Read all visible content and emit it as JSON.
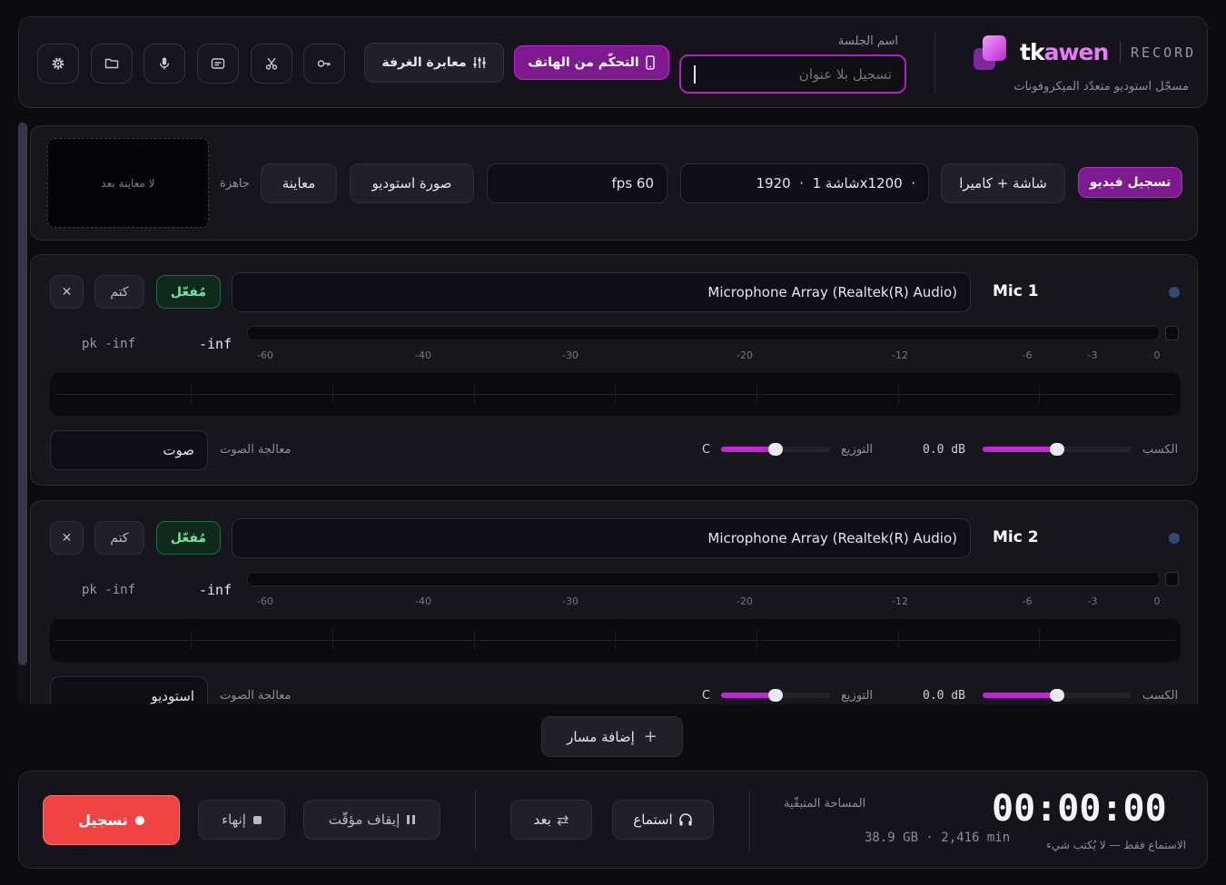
{
  "brand": {
    "tk": "tk",
    "awen": "awen",
    "record": "RECORD",
    "tagline": "مسجّل استوديو متعدّد الميكروفونات"
  },
  "session": {
    "label": "اسم الجلسة",
    "placeholder": "تسجيل بلا عنوان",
    "value": ""
  },
  "header": {
    "phone_control": "التحكّم من الهاتف",
    "room_calibration": "معايرة الغرفة"
  },
  "header_icons": [
    "key-icon",
    "scissors-icon",
    "subtitles-icon",
    "microphone-icon",
    "folder-icon",
    "settings-icon"
  ],
  "video": {
    "record_video": "تسجيل فيديو",
    "mode": "شاشة + كاميرا",
    "screen": "شاشة 1  ·  1920x1200  ·",
    "fps": "fps 60",
    "studio_image": "صورة استوديو",
    "preview": "معاينة",
    "ready": "جاهزة",
    "no_preview": "لا معاينة بعد"
  },
  "tracks": [
    {
      "name": "Mic 1",
      "device": "Microphone Array (Realtek(R) Audio)",
      "enabled": "مُفعّل",
      "mute": "كتم",
      "close": "✕",
      "level": "-inf",
      "peak": "pk -inf",
      "gain_label": "الكسب",
      "gain_value": "0.0 dB",
      "gain_level": 0.5,
      "pan_label": "التوزيع",
      "pan_value": "C",
      "pan_level": 0.5,
      "processing_label": "معالجة الصوت",
      "processing_value": "صوت"
    },
    {
      "name": "Mic 2",
      "device": "Microphone Array (Realtek(R) Audio)",
      "enabled": "مُفعّل",
      "mute": "كتم",
      "close": "✕",
      "level": "-inf",
      "peak": "pk -inf",
      "gain_label": "الكسب",
      "gain_value": "0.0 dB",
      "gain_level": 0.5,
      "pan_label": "التوزيع",
      "pan_value": "C",
      "pan_level": 0.5,
      "processing_label": "معالجة الصوت",
      "processing_value": "استوديو"
    }
  ],
  "meter_scale": [
    "-60",
    "-40",
    "-30",
    "-20",
    "-12",
    "-6",
    "-3",
    "0"
  ],
  "add_track": "إضافة مسار",
  "footer": {
    "record": "تسجيل",
    "finish": "إنهاء",
    "pause": "إيقاف مؤقّت",
    "remote": "بعد",
    "listen": "استماع",
    "space_label": "المساحة المتبقّية",
    "space_value": "38.9 GB · 2,416 min",
    "timer": "00:00:00",
    "listen_note": "الاستماع فقط — لا يُكتب شيء"
  },
  "colors": {
    "accent": "#c026d3",
    "record": "#ef4444",
    "enabled": "#6ee7a3",
    "background": "#0c0b10"
  }
}
